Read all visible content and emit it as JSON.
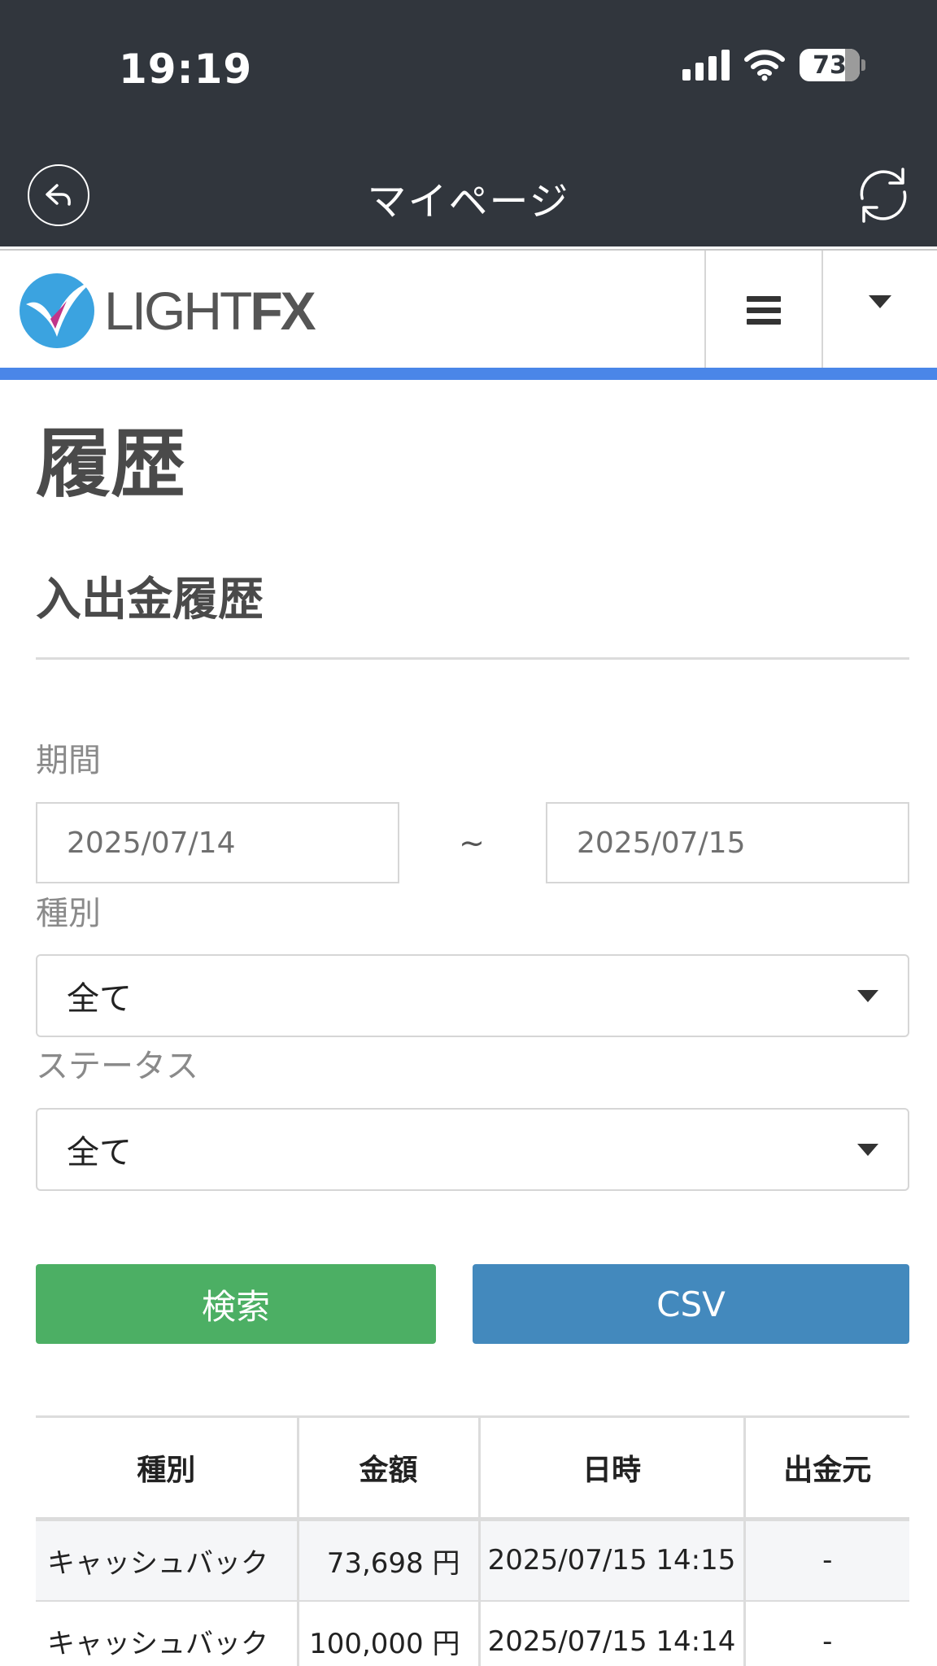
{
  "status_bar": {
    "time": "19:19",
    "battery": "73",
    "icons": [
      "signal-icon",
      "wifi-icon",
      "battery-icon"
    ]
  },
  "app_header": {
    "title": "マイページ",
    "back_icon": "back-arrow-icon",
    "reload_icon": "refresh-icon"
  },
  "site_header": {
    "logo_text_light": "LIGHT",
    "logo_text_fx": "FX",
    "menu_icon": "hamburger-menu-icon",
    "dropdown_icon": "caret-down-icon",
    "accent_color": "#4a86e8"
  },
  "page": {
    "title": "履歴",
    "section_title": "入出金履歴"
  },
  "filters": {
    "period_label": "期間",
    "date_from": "2025/07/14",
    "date_separator": "~",
    "date_to": "2025/07/15",
    "type_label": "種別",
    "type_value": "全て",
    "status_label": "ステータス",
    "status_value": "全て"
  },
  "actions": {
    "search_label": "検索",
    "search_color": "#4caf64",
    "csv_label": "CSV",
    "csv_color": "#4389bd"
  },
  "table": {
    "headers": [
      "種別",
      "金額",
      "日時",
      "出金元"
    ],
    "rows": [
      [
        "キャッシュバック",
        "73,698 円",
        "2025/07/15 14:15",
        "-"
      ],
      [
        "キャッシュバック",
        "100,000 円",
        "2025/07/15 14:14",
        "-"
      ]
    ]
  }
}
